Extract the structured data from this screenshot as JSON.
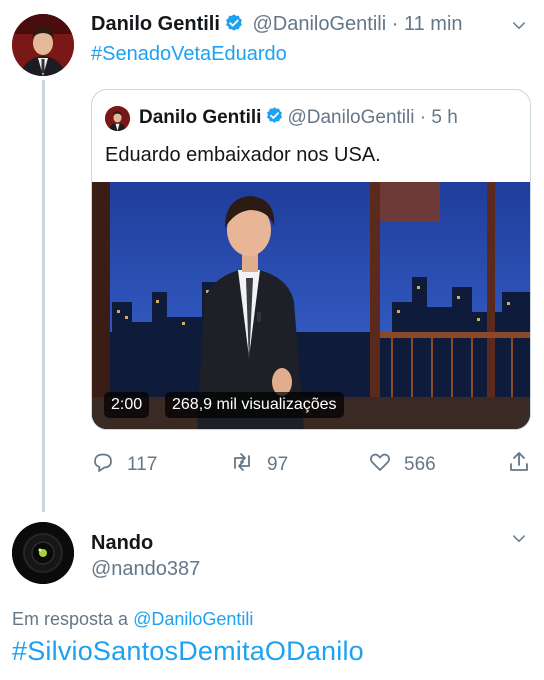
{
  "tweet": {
    "author_name": "Danilo Gentili",
    "author_handle": "@DaniloGentili",
    "separator": "·",
    "time": "11 min",
    "hashtag": "#SenadoVetaEduardo"
  },
  "quoted_tweet": {
    "author_name": "Danilo Gentili",
    "author_handle": "@DaniloGentili",
    "separator": "·",
    "time": "5 h",
    "text": "Eduardo embaixador nos USA.",
    "video": {
      "duration": "2:00",
      "views": "268,9 mil visualizações"
    }
  },
  "actions": {
    "replies": "117",
    "retweets": "97",
    "likes": "566"
  },
  "reply": {
    "author_name": "Nando",
    "author_handle": "@nando387",
    "replying_prefix": "Em resposta a",
    "replying_to": "@DaniloGentili",
    "hashtag": "#SilvioSantosDemitaODanilo"
  },
  "colors": {
    "link_blue": "#1da1f2",
    "muted_gray": "#657786",
    "verified_blue": "#1da1f2",
    "thread_line": "#ccd6dd"
  },
  "icons": [
    "verified-icon",
    "chevron-down-icon",
    "reply-icon",
    "retweet-icon",
    "like-icon",
    "share-icon"
  ]
}
